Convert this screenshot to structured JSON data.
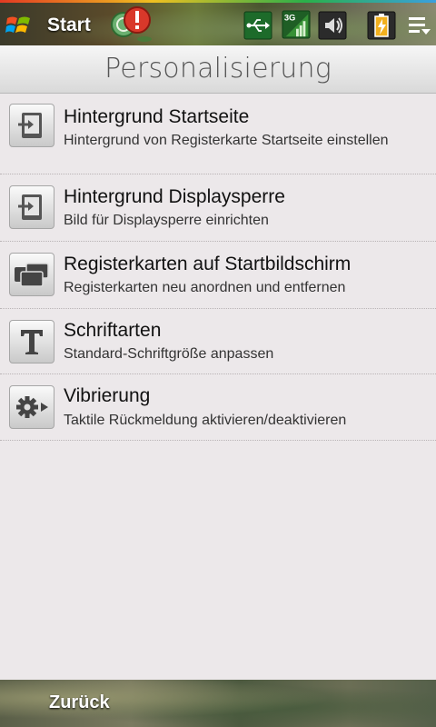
{
  "statusbar": {
    "start_label": "Start",
    "icons": [
      "windows-logo",
      "alert-icon",
      "usb-icon",
      "signal-3g-icon",
      "speaker-icon",
      "battery-icon",
      "menu-icon"
    ],
    "signal_label": "3G"
  },
  "header": {
    "title": "Personalisierung"
  },
  "items": [
    {
      "title": "Hintergrund Startseite",
      "desc": "Hintergrund von Registerkarte Startseite einstellen",
      "icon": "wallpaper-icon"
    },
    {
      "title": "Hintergrund Displaysperre",
      "desc": "Bild für Displaysperre einrichten",
      "icon": "lockscreen-icon"
    },
    {
      "title": "Registerkarten auf Startbildschirm",
      "desc": "Registerkarten neu anordnen und entfernen",
      "icon": "tabs-icon"
    },
    {
      "title": "Schriftarten",
      "desc": "Standard-Schriftgröße anpassen",
      "icon": "font-icon"
    },
    {
      "title": "Vibrierung",
      "desc": "Taktile Rückmeldung aktivieren/deaktivieren",
      "icon": "vibration-icon"
    }
  ],
  "bottombar": {
    "back_label": "Zurück"
  },
  "colors": {
    "list_background": "#ece8ea",
    "header_text": "#555555"
  }
}
